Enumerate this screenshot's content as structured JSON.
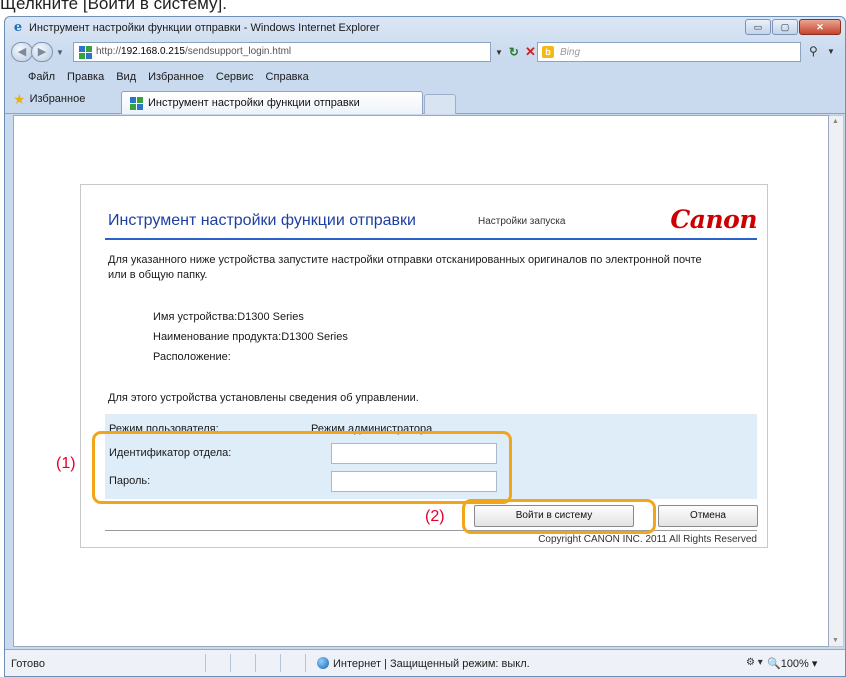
{
  "caption": "Щелкните [Войти в систему].",
  "window": {
    "title": "Инструмент настройки функции отправки - Windows Internet Explorer",
    "buttons": {
      "minimize": "▭",
      "maximize": "▢",
      "close": "✕"
    }
  },
  "nav": {
    "back_glyph": "◀",
    "forward_glyph": "▶",
    "address_prefix": "http://",
    "address_host": "192.168.0.215",
    "address_path": "/sendsupport_login.html",
    "refresh_glyph": "↻",
    "stop_glyph": "✕",
    "search_placeholder": "Bing",
    "search_glyph": "⚲"
  },
  "menu": [
    "Файл",
    "Правка",
    "Вид",
    "Избранное",
    "Сервис",
    "Справка"
  ],
  "favorites": {
    "label": "Избранное",
    "tab_title": "Инструмент настройки функции отправки"
  },
  "page": {
    "header_title": "Инструмент настройки функции отправки",
    "header_sub": "Настройки запуска",
    "logo": "Canon",
    "intro": "Для указанного ниже устройства запустите настройки отправки отсканированных оригиналов по электронной почте или в общую папку.",
    "device_name": "Имя устройства:D1300 Series",
    "product_name": "Наименование продукта:D1300 Series",
    "location": "Расположение:",
    "management_info": "Для этого устройства установлены сведения об управлении.",
    "user_mode_label": "Режим пользователя:",
    "user_mode_value": "Режим администратора",
    "department_id_label": "Идентификатор отдела:",
    "department_id_value": "",
    "password_label": "Пароль:",
    "password_value": "",
    "login_button": "Войти в систему",
    "cancel_button": "Отмена",
    "copyright": "Copyright CANON INC. 2011 All Rights Reserved"
  },
  "callouts": {
    "first": "(1)",
    "second": "(2)"
  },
  "status": {
    "ready": "Готово",
    "zone": "Интернет | Защищенный режим: выкл.",
    "tools": "⚙ ▾",
    "zoom": "🔍100%  ▾"
  },
  "colors": {
    "header_blue": "#1d3fa3",
    "canon_red": "#cc0000",
    "panel_blue": "#deedf8",
    "callout_orange": "#f3a51a",
    "callout_red": "#e3002b"
  }
}
